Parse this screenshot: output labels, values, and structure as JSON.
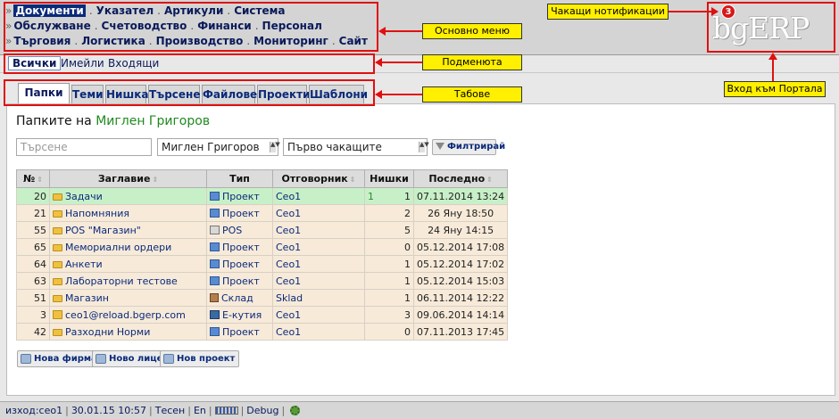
{
  "menu": {
    "row1": [
      "Документи",
      "Указател",
      "Артикули",
      "Система"
    ],
    "row2": [
      "Обслужване",
      "Счетоводство",
      "Финанси",
      "Персонал"
    ],
    "row3": [
      "Търговия",
      "Логистика",
      "Производство",
      "Мониторинг",
      "Сайт"
    ],
    "active": "Документи"
  },
  "logo": {
    "text": "bgERP"
  },
  "notifications": {
    "count": "3"
  },
  "submenu": {
    "items": [
      "Всички",
      "Имейли",
      "Входящи"
    ],
    "active": "Всички"
  },
  "tabs": {
    "items": [
      "Папки",
      "Теми",
      "Нишка",
      "Търсене",
      "Файлове",
      "Проекти",
      "Шаблони"
    ],
    "active": "Папки",
    "help": "?"
  },
  "page": {
    "title_prefix": "Папките на",
    "user": "Миглен Григоров"
  },
  "filters": {
    "search_placeholder": "Търсене",
    "user": "Миглен Григоров",
    "order": "Първо чакащите",
    "button": "Филтрирай"
  },
  "table": {
    "headers": [
      "№",
      "Заглавие",
      "Тип",
      "Отговорник",
      "Нишки",
      "Последно"
    ],
    "rows": [
      {
        "id": "20",
        "title": "Задачи",
        "type": "Проект",
        "resp": "Ceo1",
        "new": "1",
        "threads": "1",
        "last": "07.11.2014 13:24",
        "hl": true,
        "icon": "folder",
        "type_icon": "project"
      },
      {
        "id": "21",
        "title": "Напомняния",
        "type": "Проект",
        "resp": "Ceo1",
        "new": "",
        "threads": "2",
        "last": "26 Яну 18:50",
        "hl": false,
        "icon": "folder",
        "type_icon": "project"
      },
      {
        "id": "55",
        "title": "POS \"Магазин\"",
        "type": "POS",
        "resp": "Ceo1",
        "new": "",
        "threads": "5",
        "last": "24 Яну 14:15",
        "hl": false,
        "icon": "folder",
        "type_icon": "pos"
      },
      {
        "id": "65",
        "title": "Мемориални ордери",
        "type": "Проект",
        "resp": "Ceo1",
        "new": "",
        "threads": "0",
        "last": "05.12.2014 17:08",
        "hl": false,
        "icon": "folder",
        "type_icon": "project"
      },
      {
        "id": "64",
        "title": "Анкети",
        "type": "Проект",
        "resp": "Ceo1",
        "new": "",
        "threads": "1",
        "last": "05.12.2014 17:02",
        "hl": false,
        "icon": "folder",
        "type_icon": "project"
      },
      {
        "id": "63",
        "title": "Лабораторни тестове",
        "type": "Проект",
        "resp": "Ceo1",
        "new": "",
        "threads": "1",
        "last": "05.12.2014 15:03",
        "hl": false,
        "icon": "folder",
        "type_icon": "project"
      },
      {
        "id": "51",
        "title": "Магазин",
        "type": "Склад",
        "resp": "Sklad",
        "new": "",
        "threads": "1",
        "last": "06.11.2014 12:22",
        "hl": false,
        "icon": "folder",
        "type_icon": "store"
      },
      {
        "id": "3",
        "title": "ceo1@reload.bgerp.com",
        "type": "Е-кутия",
        "resp": "Ceo1",
        "new": "",
        "threads": "3",
        "last": "09.06.2014 14:14",
        "hl": false,
        "icon": "mail",
        "type_icon": "inbox"
      },
      {
        "id": "42",
        "title": "Разходни Норми",
        "type": "Проект",
        "resp": "Ceo1",
        "new": "",
        "threads": "0",
        "last": "07.11.2013 17:45",
        "hl": false,
        "icon": "folder",
        "type_icon": "project"
      }
    ]
  },
  "actions": [
    "Нова фирма",
    "Ново лице",
    "Нов проект"
  ],
  "footer": {
    "user": "изход:ceo1",
    "datetime": "30.01.15 10:57",
    "mode": "Тесен",
    "lang": "En",
    "debug": "Debug"
  },
  "annotations": {
    "notifications": "Чакащи нотификации",
    "main_menu": "Основно меню",
    "submenus": "Подменюта",
    "tabs": "Табове",
    "portal": "Вход към Портала"
  },
  "colors": {
    "annotation": "#e01010",
    "label_bg": "#ffef00",
    "highlight_row": "#c8f0c8",
    "row_bg": "#f7ead9"
  }
}
